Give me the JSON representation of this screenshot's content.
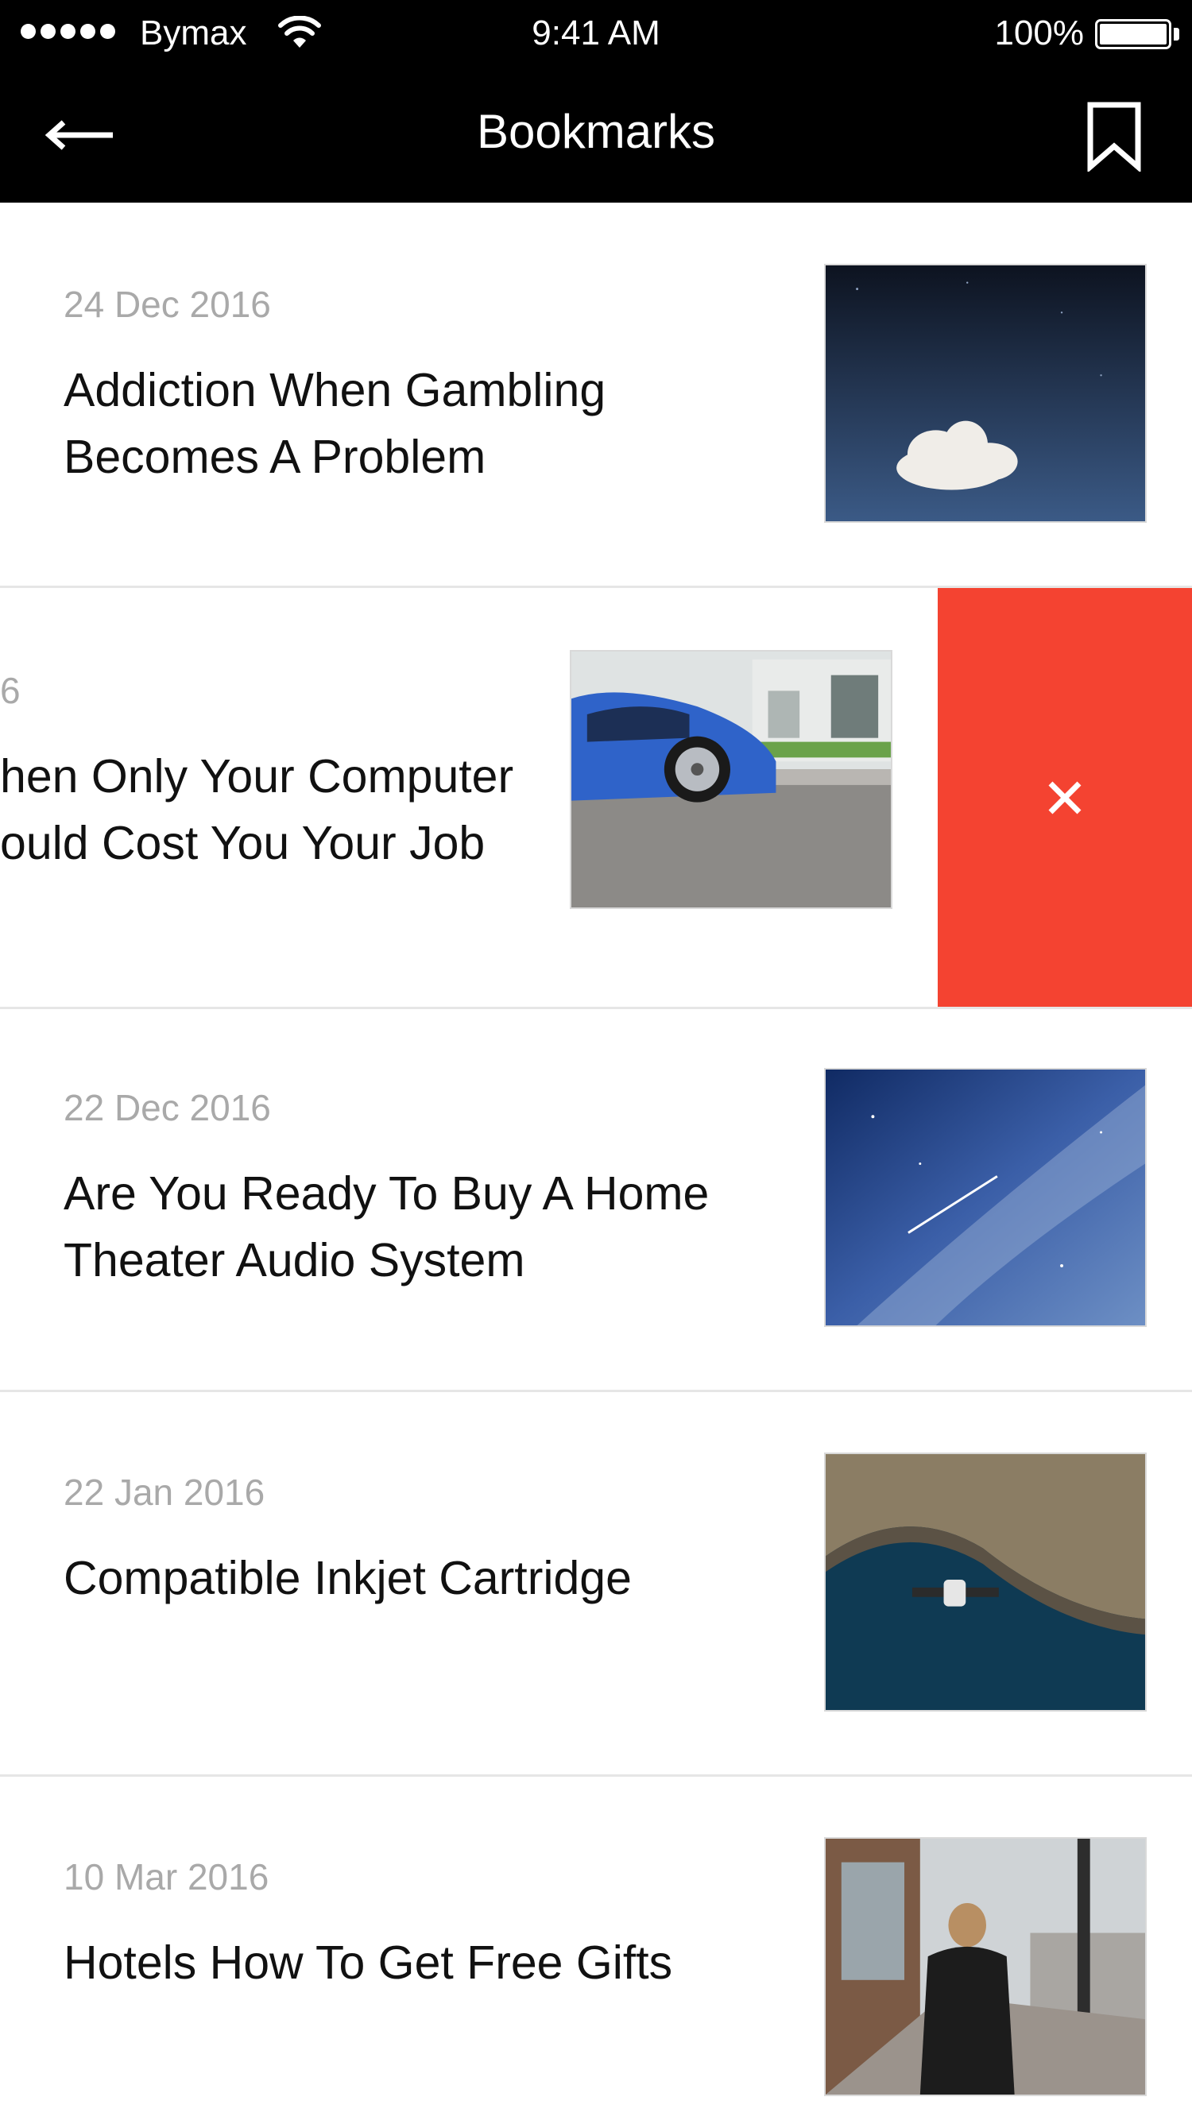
{
  "status_bar": {
    "carrier": "Bymax",
    "time": "9:41 AM",
    "battery": "100%"
  },
  "nav": {
    "title": "Bookmarks",
    "back_icon": "back-arrow-icon",
    "bookmark_icon": "bookmark-icon"
  },
  "items": [
    {
      "date": "24 Dec 2016",
      "title_line1": "Addiction When Gambling",
      "title_line2": "Becomes A Problem",
      "image": "night sky with a cloud"
    },
    {
      "date": "6",
      "title_line1": "hen Only Your Computer",
      "title_line2": "ould Cost You Your Job",
      "image": "blue sports car",
      "swiped": true
    },
    {
      "date": "22 Dec 2016",
      "title_line1": "Are You Ready To Buy A Home",
      "title_line2": "Theater Audio System",
      "image": "milky way with a meteor"
    },
    {
      "date": "22 Jan 2016",
      "title_line1": "Compatible Inkjet Cartridge",
      "title_line2": "",
      "image": "satellite over coastline"
    },
    {
      "date": "10 Mar 2016",
      "title_line1": "Hotels How To Get Free Gifts",
      "title_line2": "",
      "image": "person walking on street"
    }
  ],
  "delete_action": {
    "icon": "close-icon",
    "color": "#f44331"
  },
  "colors": {
    "bar": "#000000",
    "date": "#a9a9a9",
    "accent": "#f44331",
    "divider": "#e6e6e6"
  }
}
